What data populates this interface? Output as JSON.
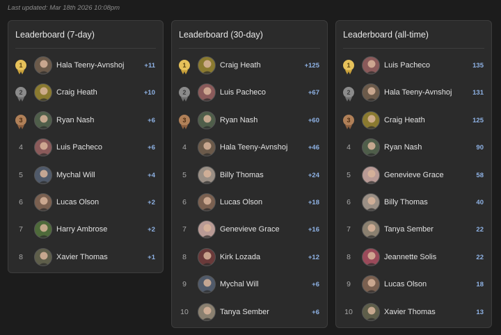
{
  "last_updated": "Last updated: Mar 18th 2026 10:08pm",
  "colors": {
    "score": "#8fb3e6",
    "gold": "#e6c15a",
    "silver": "#8b8b8b",
    "bronze": "#b08058"
  },
  "boards": [
    {
      "title": "Leaderboard (7-day)",
      "rows": [
        {
          "rank": "1",
          "name": "Hala Teeny-Avnshoj",
          "score": "+11",
          "medal": "gold",
          "avatar": "#6b5a4a"
        },
        {
          "rank": "2",
          "name": "Craig Heath",
          "score": "+10",
          "medal": "silver",
          "avatar": "#8a7a30"
        },
        {
          "rank": "3",
          "name": "Ryan Nash",
          "score": "+6",
          "medal": "bronze",
          "avatar": "#4f5e4a"
        },
        {
          "rank": "4",
          "name": "Luis Pacheco",
          "score": "+6",
          "medal": "",
          "avatar": "#8a5a5a"
        },
        {
          "rank": "5",
          "name": "Mychal Will",
          "score": "+4",
          "medal": "",
          "avatar": "#505a6a"
        },
        {
          "rank": "6",
          "name": "Lucas Olson",
          "score": "+2",
          "medal": "",
          "avatar": "#7a6050"
        },
        {
          "rank": "7",
          "name": "Harry Ambrose",
          "score": "+2",
          "medal": "",
          "avatar": "#4e6a3a"
        },
        {
          "rank": "8",
          "name": "Xavier Thomas",
          "score": "+1",
          "medal": "",
          "avatar": "#5e5e4a"
        }
      ]
    },
    {
      "title": "Leaderboard (30-day)",
      "rows": [
        {
          "rank": "1",
          "name": "Craig Heath",
          "score": "+125",
          "medal": "gold",
          "avatar": "#8a7a30"
        },
        {
          "rank": "2",
          "name": "Luis Pacheco",
          "score": "+67",
          "medal": "silver",
          "avatar": "#8a5a5a"
        },
        {
          "rank": "3",
          "name": "Ryan Nash",
          "score": "+60",
          "medal": "bronze",
          "avatar": "#4f5e4a"
        },
        {
          "rank": "4",
          "name": "Hala Teeny-Avnshoj",
          "score": "+46",
          "medal": "",
          "avatar": "#6b5a4a"
        },
        {
          "rank": "5",
          "name": "Billy Thomas",
          "score": "+24",
          "medal": "",
          "avatar": "#9a8f85"
        },
        {
          "rank": "6",
          "name": "Lucas Olson",
          "score": "+18",
          "medal": "",
          "avatar": "#7a6050"
        },
        {
          "rank": "7",
          "name": "Genevieve Grace",
          "score": "+16",
          "medal": "",
          "avatar": "#b89a95"
        },
        {
          "rank": "8",
          "name": "Kirk Lozada",
          "score": "+12",
          "medal": "",
          "avatar": "#6a3a3a"
        },
        {
          "rank": "9",
          "name": "Mychal Will",
          "score": "+6",
          "medal": "",
          "avatar": "#505a6a"
        },
        {
          "rank": "10",
          "name": "Tanya Sember",
          "score": "+6",
          "medal": "",
          "avatar": "#8a8070"
        }
      ]
    },
    {
      "title": "Leaderboard (all-time)",
      "rows": [
        {
          "rank": "1",
          "name": "Luis Pacheco",
          "score": "135",
          "medal": "gold",
          "avatar": "#8a5a5a"
        },
        {
          "rank": "2",
          "name": "Hala Teeny-Avnshoj",
          "score": "131",
          "medal": "silver",
          "avatar": "#6b5a4a"
        },
        {
          "rank": "3",
          "name": "Craig Heath",
          "score": "125",
          "medal": "bronze",
          "avatar": "#8a7a30"
        },
        {
          "rank": "4",
          "name": "Ryan Nash",
          "score": "90",
          "medal": "",
          "avatar": "#4f5e4a"
        },
        {
          "rank": "5",
          "name": "Genevieve Grace",
          "score": "58",
          "medal": "",
          "avatar": "#b89a95"
        },
        {
          "rank": "6",
          "name": "Billy Thomas",
          "score": "40",
          "medal": "",
          "avatar": "#9a8f85"
        },
        {
          "rank": "7",
          "name": "Tanya Sember",
          "score": "22",
          "medal": "",
          "avatar": "#8a8070"
        },
        {
          "rank": "8",
          "name": "Jeannette Solis",
          "score": "22",
          "medal": "",
          "avatar": "#9a4a5a"
        },
        {
          "rank": "9",
          "name": "Lucas Olson",
          "score": "18",
          "medal": "",
          "avatar": "#7a6050"
        },
        {
          "rank": "10",
          "name": "Xavier Thomas",
          "score": "13",
          "medal": "",
          "avatar": "#5e5e4a"
        }
      ]
    }
  ]
}
